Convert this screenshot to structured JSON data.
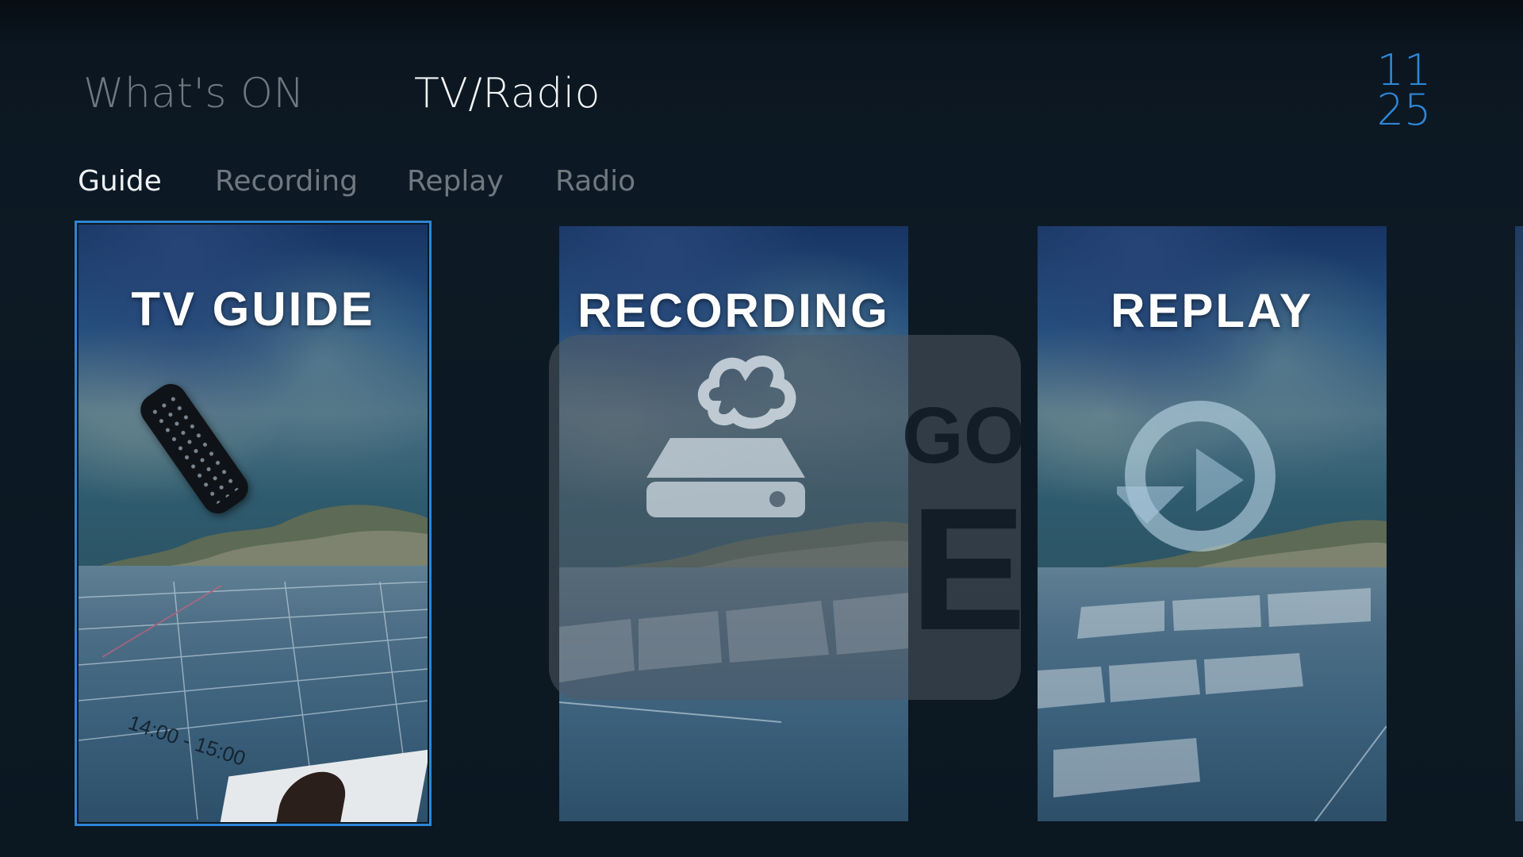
{
  "header": {
    "tabs": [
      {
        "label": "What's ON",
        "active": false
      },
      {
        "label": "TV/Radio",
        "active": true
      }
    ],
    "clock": {
      "hours": "11",
      "minutes": "25"
    }
  },
  "subnav": {
    "tabs": [
      {
        "label": "Guide",
        "active": true
      },
      {
        "label": "Recording",
        "active": false
      },
      {
        "label": "Replay",
        "active": false
      },
      {
        "label": "Radio",
        "active": false
      }
    ]
  },
  "tiles": [
    {
      "title": "TV GUIDE",
      "icon": "remote-control-icon",
      "focused": true,
      "time_text": "14:00 - 15:00"
    },
    {
      "title": "RECORDING",
      "icon": "cloud-recorder-icon",
      "focused": false
    },
    {
      "title": "REPLAY",
      "icon": "replay-circle-arrows-icon",
      "focused": false
    }
  ],
  "overlay": {
    "letters_top": "GO",
    "letters_bottom": "E"
  },
  "colors": {
    "accent": "#2d86d6",
    "background": "#0b1620",
    "active_text": "#f2f4f6",
    "inactive_text": "#6f7880"
  }
}
